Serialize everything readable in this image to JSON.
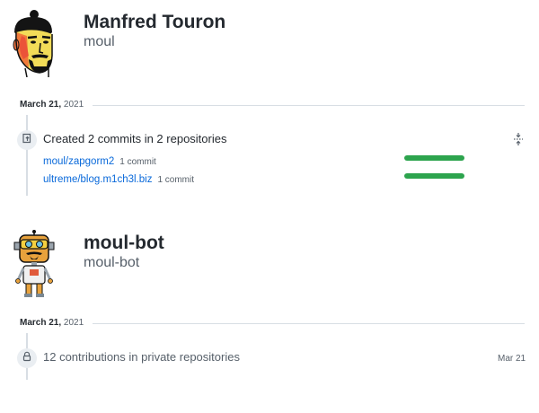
{
  "users": [
    {
      "name": "Manfred Touron",
      "login": "moul",
      "date": {
        "month_day": "March 21,",
        "year": "2021"
      },
      "activity": {
        "summary": "Created 2 commits in 2 repositories",
        "icon": "repo-push-icon",
        "repos": [
          {
            "name": "moul/zapgorm2",
            "commits": "1 commit",
            "share": 1.0
          },
          {
            "name": "ultreme/blog.m1ch3l.biz",
            "commits": "1 commit",
            "share": 1.0
          }
        ]
      }
    },
    {
      "name": "moul-bot",
      "login": "moul-bot",
      "date": {
        "month_day": "March 21,",
        "year": "2021"
      },
      "activity": {
        "summary": "12 contributions in private repositories",
        "icon": "lock-icon",
        "date": "Mar 21"
      }
    }
  ],
  "colors": {
    "link": "#0969da",
    "bar": "#2da44e",
    "line": "#d8dee4",
    "badge_bg": "#eaeef2"
  }
}
